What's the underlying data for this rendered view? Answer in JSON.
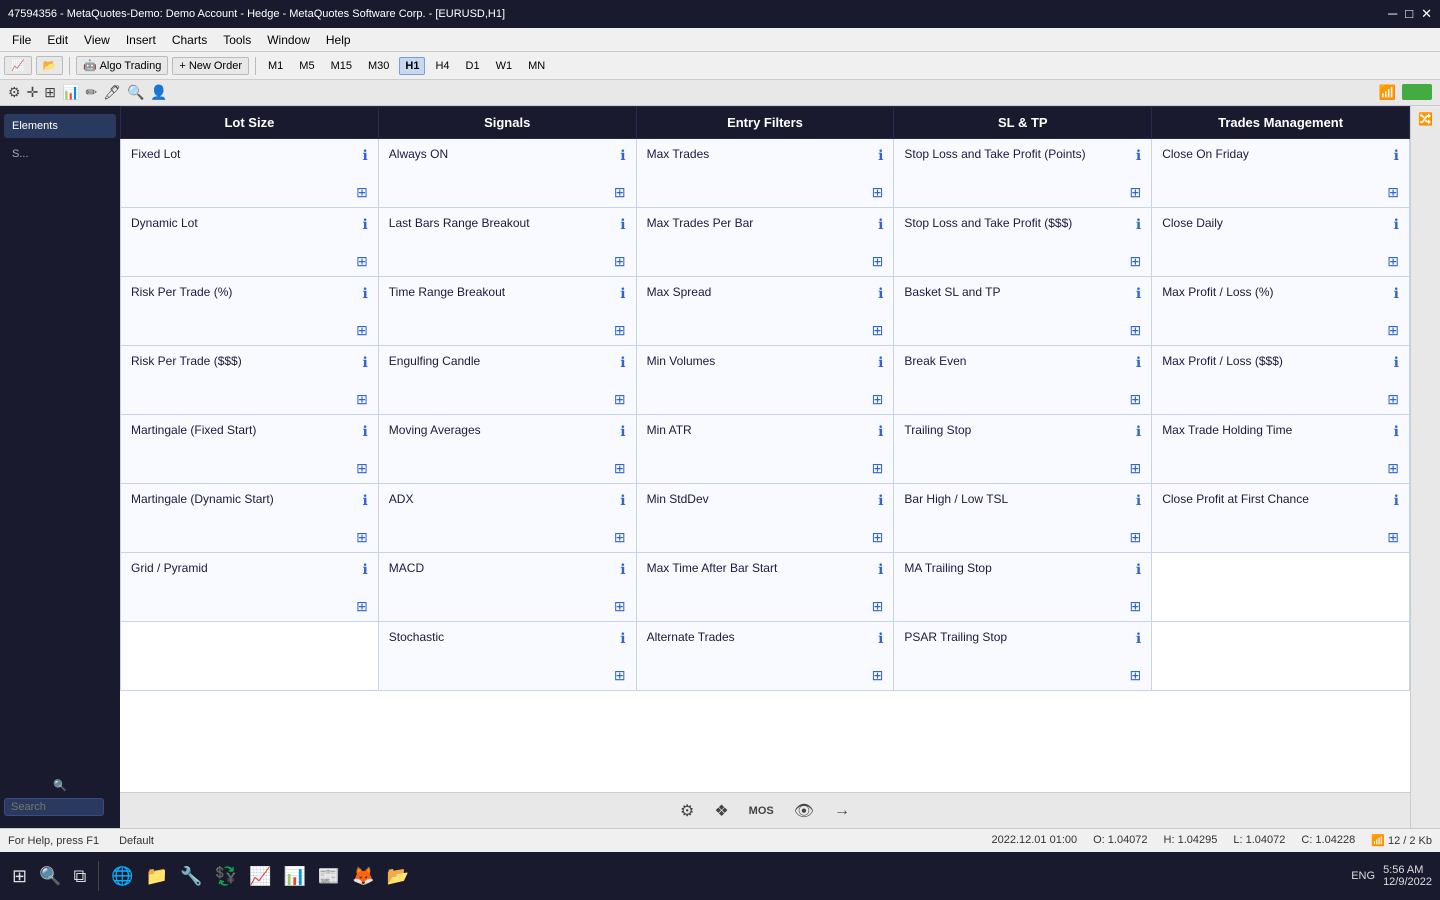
{
  "titleBar": {
    "title": "47594356 - MetaQuotes-Demo: Demo Account - Hedge - MetaQuotes Software Corp. - [EURUSD,H1]"
  },
  "menuBar": {
    "items": [
      "File",
      "Edit",
      "View",
      "Insert",
      "Charts",
      "Tools",
      "Window",
      "Help"
    ]
  },
  "toolbar": {
    "algoTrading": "Algo Trading",
    "newOrder": "New Order",
    "timeframes": [
      "M1",
      "M5",
      "M15",
      "M30",
      "H1",
      "H4",
      "D1",
      "W1",
      "MN"
    ],
    "activeTimeframe": "H1"
  },
  "tabs": {
    "items": [
      "Elements",
      "S..."
    ],
    "active": 0
  },
  "search": {
    "placeholder": "Search"
  },
  "columns": [
    {
      "key": "lotSize",
      "label": "Lot Size"
    },
    {
      "key": "signals",
      "label": "Signals"
    },
    {
      "key": "entryFilters",
      "label": "Entry Filters"
    },
    {
      "key": "slTp",
      "label": "SL & TP"
    },
    {
      "key": "tradesManagement",
      "label": "Trades Management"
    }
  ],
  "gridRows": [
    [
      {
        "title": "Fixed Lot"
      },
      {
        "title": "Always ON"
      },
      {
        "title": "Max Trades"
      },
      {
        "title": "Stop Loss and Take Profit (Points)"
      },
      {
        "title": "Close On Friday"
      }
    ],
    [
      {
        "title": "Dynamic Lot"
      },
      {
        "title": "Last Bars Range Breakout"
      },
      {
        "title": "Max Trades Per Bar"
      },
      {
        "title": "Stop Loss and Take Profit ($$$)"
      },
      {
        "title": "Close Daily"
      }
    ],
    [
      {
        "title": "Risk Per Trade (%)"
      },
      {
        "title": "Time Range Breakout"
      },
      {
        "title": "Max Spread"
      },
      {
        "title": "Basket SL and TP"
      },
      {
        "title": "Max Profit / Loss (%)"
      }
    ],
    [
      {
        "title": "Risk Per Trade ($$$)"
      },
      {
        "title": "Engulfing Candle"
      },
      {
        "title": "Min Volumes"
      },
      {
        "title": "Break Even"
      },
      {
        "title": "Max Profit / Loss ($$$)"
      }
    ],
    [
      {
        "title": "Martingale (Fixed Start)"
      },
      {
        "title": "Moving Averages"
      },
      {
        "title": "Min ATR"
      },
      {
        "title": "Trailing Stop"
      },
      {
        "title": "Max Trade Holding Time"
      }
    ],
    [
      {
        "title": "Martingale (Dynamic Start)"
      },
      {
        "title": "ADX"
      },
      {
        "title": "Min StdDev"
      },
      {
        "title": "Bar High / Low TSL"
      },
      {
        "title": "Close Profit at First Chance"
      }
    ],
    [
      {
        "title": "Grid / Pyramid"
      },
      {
        "title": "MACD"
      },
      {
        "title": "Max Time After Bar Start"
      },
      {
        "title": "MA Trailing Stop"
      },
      {
        "title": ""
      }
    ],
    [
      {
        "title": ""
      },
      {
        "title": "Stochastic"
      },
      {
        "title": "Alternate Trades"
      },
      {
        "title": "PSAR Trailing Stop"
      },
      {
        "title": ""
      }
    ]
  ],
  "panelBottom": {
    "icons": [
      "⚙",
      "✦",
      "♦",
      "👁",
      "→"
    ]
  },
  "statusBar": {
    "helpText": "For Help, press F1",
    "mode": "Default",
    "timestamp": "2022.12.01 01:00",
    "open": "O: 1.04072",
    "high": "H: 1.04295",
    "low": "L: 1.04072",
    "close": "C: 1.04228"
  },
  "taskbar": {
    "time": "5:56 AM",
    "date": "12/9/2022",
    "lang": "ENG"
  }
}
